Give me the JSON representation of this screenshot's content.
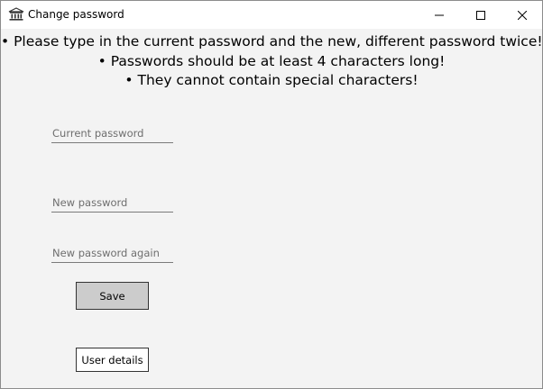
{
  "window": {
    "title": "Change password",
    "icon": "bank-building-icon"
  },
  "instructions": [
    "• Please type in the current password and the new, different password twice!",
    "• Passwords should be at least 4 characters long!",
    "• They cannot contain special characters!"
  ],
  "form": {
    "current_password": {
      "placeholder": "Current password",
      "value": ""
    },
    "new_password": {
      "placeholder": "New password",
      "value": ""
    },
    "new_password_again": {
      "placeholder": "New password again",
      "value": ""
    }
  },
  "buttons": {
    "save_label": "Save",
    "user_details_label": "User details"
  },
  "colors": {
    "window_background": "#f3f3f3",
    "titlebar_background": "#ffffff",
    "save_button_background": "#cccccc"
  }
}
